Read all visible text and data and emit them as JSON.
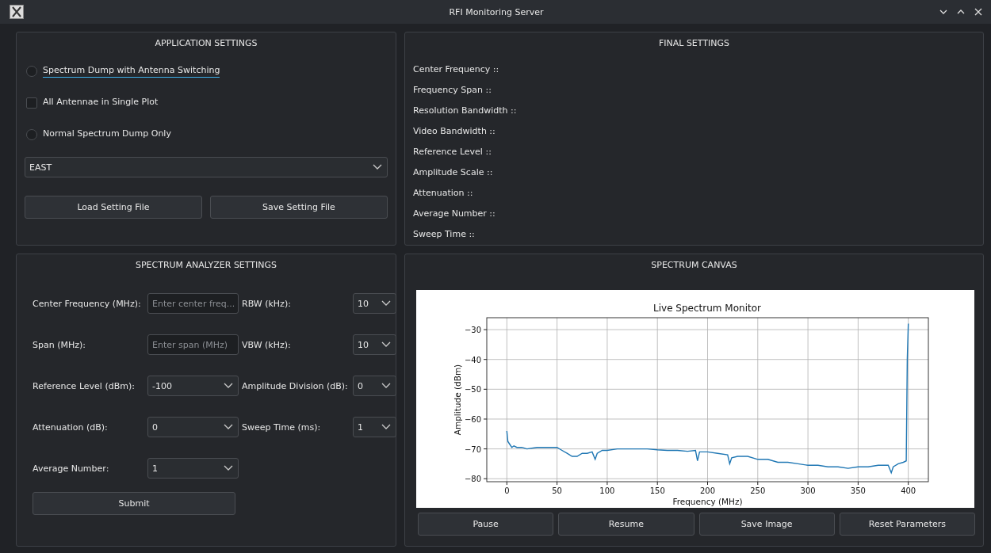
{
  "window": {
    "title": "RFI Monitoring Server"
  },
  "application_settings": {
    "title": "APPLICATION SETTINGS",
    "options": [
      {
        "kind": "radio",
        "label": "Spectrum Dump with Antenna Switching",
        "checked": false,
        "focused": true
      },
      {
        "kind": "checkbox",
        "label": "All Antennae in Single Plot",
        "checked": false,
        "focused": false
      },
      {
        "kind": "radio",
        "label": "Normal Spectrum Dump Only",
        "checked": false,
        "focused": false
      }
    ],
    "direction": {
      "value": "EAST"
    },
    "buttons": [
      "Load Setting File",
      "Save Setting File"
    ]
  },
  "final_settings": {
    "title": "FINAL SETTINGS",
    "items": [
      "Center Frequency ::",
      "Frequency Span ::",
      "Resolution Bandwidth ::",
      "Video Bandwidth ::",
      "Reference Level ::",
      "Amplitude Scale ::",
      "Attenuation ::",
      "Average Number ::",
      "Sweep Time ::"
    ]
  },
  "spectrum_analyzer_settings": {
    "title": "SPECTRUM ANALYZER SETTINGS",
    "fields": [
      {
        "label": "Center Frequency (MHz):",
        "kind": "input",
        "placeholder": "Enter center freq..."
      },
      {
        "label": "RBW (kHz):",
        "kind": "select",
        "value": "10"
      },
      {
        "label": "Span (MHz):",
        "kind": "input",
        "placeholder": "Enter span (MHz)"
      },
      {
        "label": "VBW (kHz):",
        "kind": "select",
        "value": "10"
      },
      {
        "label": "Reference Level (dBm):",
        "kind": "select",
        "value": "-100"
      },
      {
        "label": "Amplitude Division (dB):",
        "kind": "select",
        "value": "0"
      },
      {
        "label": "Attenuation (dB):",
        "kind": "select",
        "value": "0"
      },
      {
        "label": "Sweep Time (ms):",
        "kind": "select",
        "value": "1"
      },
      {
        "label": "Average Number:",
        "kind": "select",
        "value": "1"
      }
    ],
    "submit": "Submit"
  },
  "spectrum_canvas": {
    "title": "SPECTRUM CANVAS",
    "chart_data": {
      "type": "line",
      "title": "Live Spectrum Monitor",
      "xlabel": "Frequency (MHz)",
      "ylabel": "Amplitude (dBm)",
      "x": [
        0,
        1,
        3,
        5,
        7,
        10,
        15,
        20,
        30,
        40,
        50,
        55,
        60,
        65,
        70,
        75,
        80,
        85,
        88,
        90,
        95,
        100,
        110,
        120,
        130,
        140,
        150,
        160,
        170,
        180,
        188,
        190,
        192,
        200,
        210,
        220,
        222,
        224,
        230,
        240,
        250,
        260,
        270,
        280,
        290,
        300,
        310,
        320,
        330,
        340,
        350,
        360,
        370,
        380,
        383,
        385,
        390,
        395,
        398,
        399,
        400
      ],
      "series": [
        {
          "color": "#1f77b4",
          "values": [
            -64,
            -67.5,
            -68.5,
            -69.5,
            -69,
            -69.5,
            -69.5,
            -70,
            -69.5,
            -69.5,
            -69.5,
            -70.5,
            -71.5,
            -72.5,
            -72.5,
            -71.5,
            -71.5,
            -71,
            -73.5,
            -71.5,
            -70.5,
            -70.5,
            -70,
            -70,
            -70,
            -70,
            -70.3,
            -70.5,
            -70.5,
            -70.8,
            -70.5,
            -74,
            -71,
            -71,
            -71.5,
            -72,
            -75,
            -73,
            -72.5,
            -72.5,
            -73.5,
            -73.5,
            -74.5,
            -74.5,
            -75,
            -75.5,
            -75.5,
            -76,
            -76,
            -76.5,
            -76,
            -76,
            -75.5,
            -75.5,
            -78,
            -76,
            -75,
            -74.5,
            -74,
            -40,
            -28
          ]
        }
      ],
      "grid": true,
      "xlim": [
        -20,
        420
      ],
      "ylim": [
        -81,
        -26
      ],
      "xticks": [
        0,
        50,
        100,
        150,
        200,
        250,
        300,
        350,
        400
      ],
      "yticks": [
        -80,
        -70,
        -60,
        -50,
        -40,
        -30
      ]
    },
    "buttons": [
      "Pause",
      "Resume",
      "Save Image",
      "Reset Parameters"
    ]
  }
}
